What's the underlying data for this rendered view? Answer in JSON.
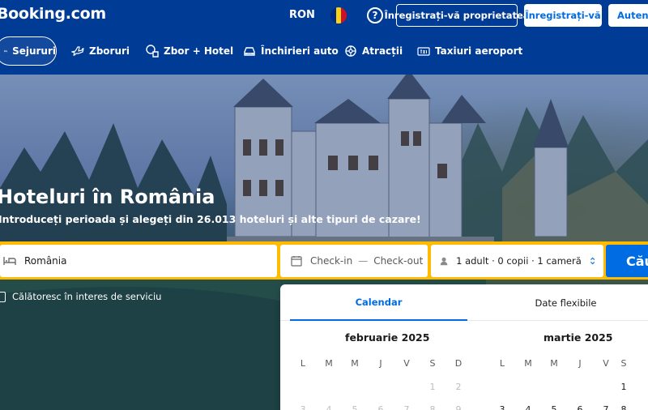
{
  "header": {
    "logo": "Booking.com",
    "currency": "RON",
    "help_symbol": "?",
    "list_property": "Înregistrați-vă proprietatea",
    "register": "Înregistrați-vă",
    "sign_in": "Autentificați-vă"
  },
  "nav": {
    "items": [
      {
        "label": "Sejururi",
        "icon": "bed-icon",
        "active": true
      },
      {
        "label": "Zboruri",
        "icon": "plane-icon"
      },
      {
        "label": "Zbor + Hotel",
        "icon": "flight-hotel-icon"
      },
      {
        "label": "Închirieri auto",
        "icon": "car-icon"
      },
      {
        "label": "Atracții",
        "icon": "attractions-icon"
      },
      {
        "label": "Taxiuri aeroport",
        "icon": "taxi-icon"
      }
    ]
  },
  "hero": {
    "title": "Hoteluri în România",
    "subtitle": "Introduceți perioada și alegeți din 26.013 hoteluri și alte tipuri de cazare!"
  },
  "search": {
    "destination": "România",
    "check_in": "Check-in",
    "dash": "—",
    "check_out": "Check-out",
    "guests": "1 adult · 0 copii · 1 cameră",
    "submit": "Căutați"
  },
  "business_travel": "Călătoresc în interes de serviciu",
  "calendar": {
    "tabs": [
      "Calendar",
      "Date flexibile"
    ],
    "months": [
      {
        "name": "februarie 2025",
        "weekdays": [
          "L",
          "M",
          "M",
          "J",
          "V",
          "S",
          "D"
        ],
        "rows": [
          [
            "",
            "",
            "",
            "",
            "",
            "1",
            "2"
          ],
          [
            "3",
            "4",
            "5",
            "6",
            "7",
            "8",
            "9"
          ]
        ]
      },
      {
        "name": "martie 2025",
        "weekdays": [
          "L",
          "M",
          "M",
          "J",
          "V",
          "S"
        ],
        "rows": [
          [
            "",
            "",
            "",
            "",
            "",
            "1"
          ],
          [
            "3",
            "4",
            "5",
            "6",
            "7",
            "8"
          ]
        ]
      }
    ]
  },
  "colors": {
    "brand_blue": "#003b95",
    "accent_blue": "#006ce4",
    "search_yellow": "#febb02",
    "flag_blue": "#002b7f",
    "flag_yellow": "#fcd116",
    "flag_red": "#ce1126"
  }
}
